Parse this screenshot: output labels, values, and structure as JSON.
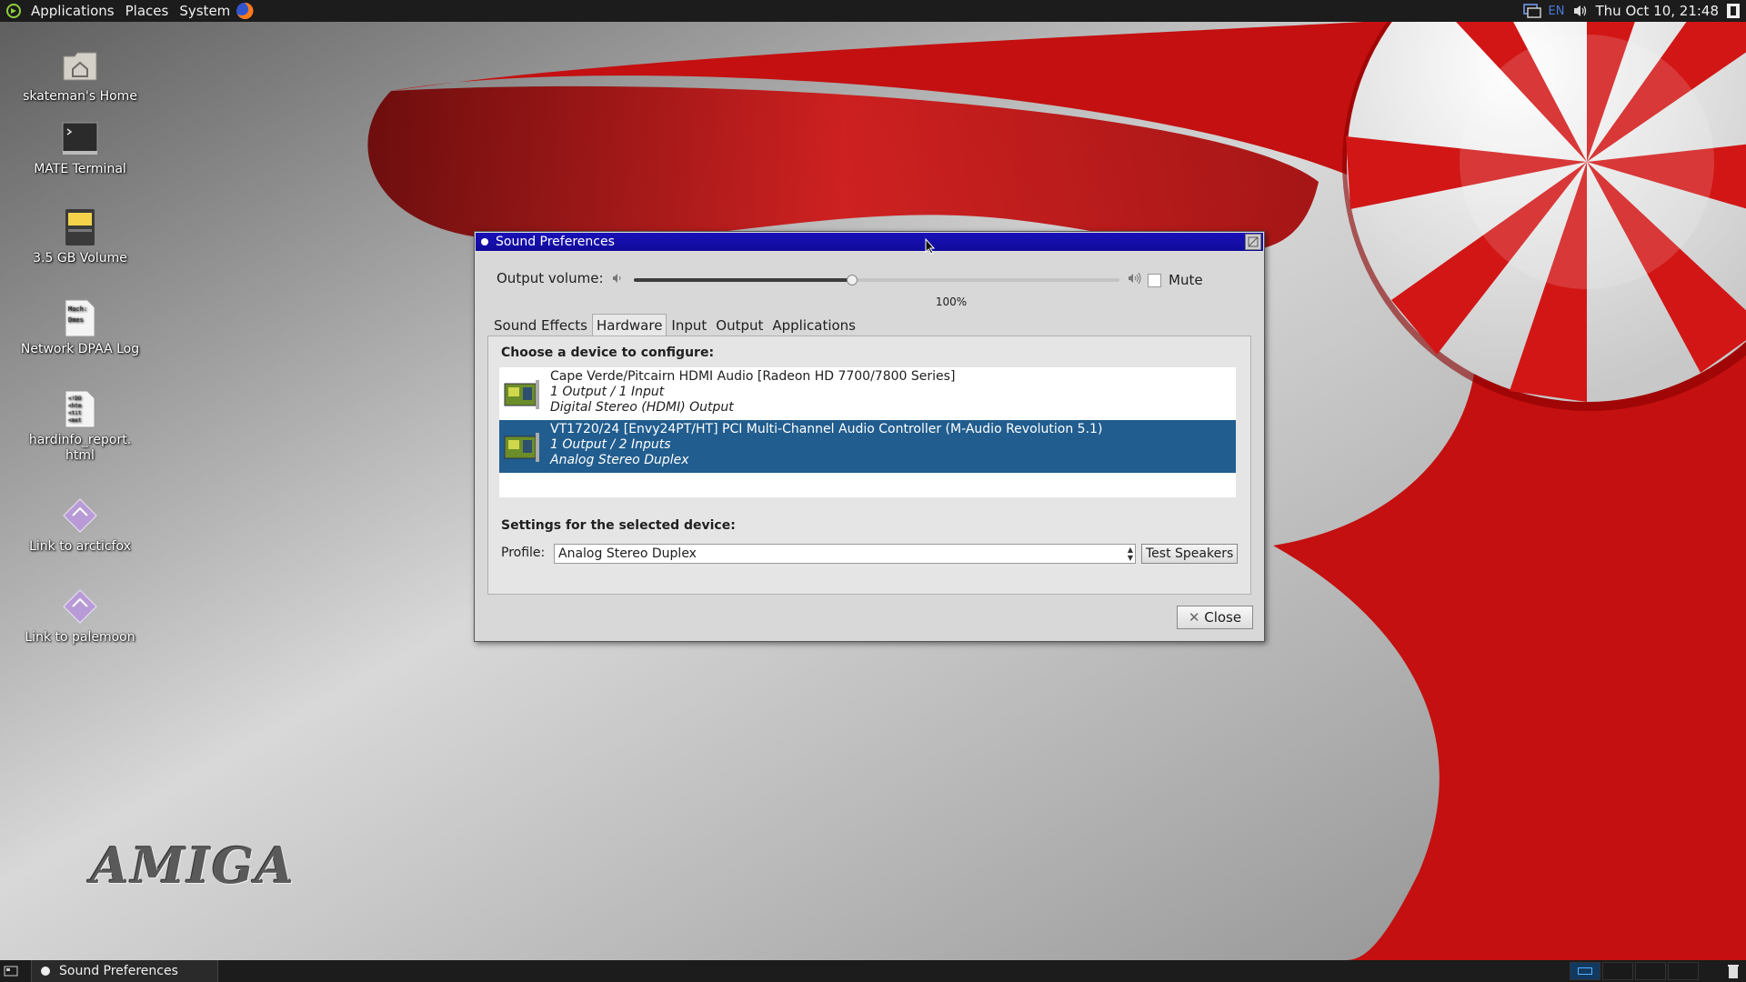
{
  "top_panel": {
    "menus": [
      "Applications",
      "Places",
      "System"
    ],
    "lang": "EN",
    "clock": "Thu Oct 10, 21:48"
  },
  "desktop": {
    "icons": [
      {
        "label": "skateman's Home"
      },
      {
        "label": "MATE Terminal"
      },
      {
        "label": "3.5 GB Volume"
      },
      {
        "label": "Network DPAA Log"
      },
      {
        "label": "hardinfo_report.\nhtml"
      },
      {
        "label": "Link to arcticfox"
      },
      {
        "label": "Link to palemoon"
      }
    ],
    "watermark": "AMIGA"
  },
  "window": {
    "title": "Sound Preferences",
    "output_volume_label": "Output volume:",
    "volume_level": 0.45,
    "volume_pct": "100%",
    "mute_label": "Mute",
    "tabs": [
      "Sound Effects",
      "Hardware",
      "Input",
      "Output",
      "Applications"
    ],
    "active_tab": "Hardware",
    "choose_heading": "Choose a device to configure:",
    "devices": [
      {
        "name": "Cape Verde/Pitcairn HDMI Audio [Radeon HD 7700/7800 Series]",
        "ports": "1 Output / 1 Input",
        "profile": "Digital Stereo (HDMI) Output"
      },
      {
        "name": "VT1720/24 [Envy24PT/HT] PCI Multi-Channel Audio Controller (M-Audio Revolution 5.1)",
        "ports": "1 Output / 2 Inputs",
        "profile": "Analog Stereo Duplex"
      }
    ],
    "settings_heading": "Settings for the selected device:",
    "profile_label": "Profile:",
    "profile_value": "Analog Stereo Duplex",
    "test_speakers_label": "Test Speakers",
    "close_label": "Close"
  },
  "bottom_panel": {
    "task_label": "Sound Preferences"
  }
}
